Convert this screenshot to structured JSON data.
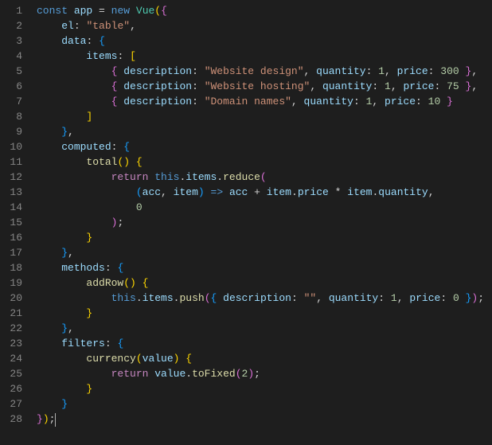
{
  "editor": {
    "line_count": 28,
    "cursor_line": 28,
    "language": "javascript"
  },
  "tokens": {
    "l1": [
      [
        "kw",
        "const"
      ],
      [
        "pun",
        " "
      ],
      [
        "var",
        "app"
      ],
      [
        "pun",
        " "
      ],
      [
        "pun",
        "="
      ],
      [
        "pun",
        " "
      ],
      [
        "kw",
        "new"
      ],
      [
        "pun",
        " "
      ],
      [
        "cls",
        "Vue"
      ],
      [
        "brk1",
        "("
      ],
      [
        "brk2",
        "{"
      ]
    ],
    "l2": [
      [
        "pun",
        "    "
      ],
      [
        "var",
        "el"
      ],
      [
        "pun",
        ":"
      ],
      [
        "pun",
        " "
      ],
      [
        "str",
        "\"table\""
      ],
      [
        "pun",
        ","
      ]
    ],
    "l3": [
      [
        "pun",
        "    "
      ],
      [
        "var",
        "data"
      ],
      [
        "pun",
        ":"
      ],
      [
        "pun",
        " "
      ],
      [
        "brk3",
        "{"
      ]
    ],
    "l4": [
      [
        "pun",
        "        "
      ],
      [
        "var",
        "items"
      ],
      [
        "pun",
        ":"
      ],
      [
        "pun",
        " "
      ],
      [
        "brk1",
        "["
      ]
    ],
    "l5": [
      [
        "pun",
        "            "
      ],
      [
        "brk2",
        "{"
      ],
      [
        "pun",
        " "
      ],
      [
        "var",
        "description"
      ],
      [
        "pun",
        ":"
      ],
      [
        "pun",
        " "
      ],
      [
        "str",
        "\"Website design\""
      ],
      [
        "pun",
        ","
      ],
      [
        "pun",
        " "
      ],
      [
        "var",
        "quantity"
      ],
      [
        "pun",
        ":"
      ],
      [
        "pun",
        " "
      ],
      [
        "num",
        "1"
      ],
      [
        "pun",
        ","
      ],
      [
        "pun",
        " "
      ],
      [
        "var",
        "price"
      ],
      [
        "pun",
        ":"
      ],
      [
        "pun",
        " "
      ],
      [
        "num",
        "300"
      ],
      [
        "pun",
        " "
      ],
      [
        "brk2",
        "}"
      ],
      [
        "pun",
        ","
      ]
    ],
    "l6": [
      [
        "pun",
        "            "
      ],
      [
        "brk2",
        "{"
      ],
      [
        "pun",
        " "
      ],
      [
        "var",
        "description"
      ],
      [
        "pun",
        ":"
      ],
      [
        "pun",
        " "
      ],
      [
        "str",
        "\"Website hosting\""
      ],
      [
        "pun",
        ","
      ],
      [
        "pun",
        " "
      ],
      [
        "var",
        "quantity"
      ],
      [
        "pun",
        ":"
      ],
      [
        "pun",
        " "
      ],
      [
        "num",
        "1"
      ],
      [
        "pun",
        ","
      ],
      [
        "pun",
        " "
      ],
      [
        "var",
        "price"
      ],
      [
        "pun",
        ":"
      ],
      [
        "pun",
        " "
      ],
      [
        "num",
        "75"
      ],
      [
        "pun",
        " "
      ],
      [
        "brk2",
        "}"
      ],
      [
        "pun",
        ","
      ]
    ],
    "l7": [
      [
        "pun",
        "            "
      ],
      [
        "brk2",
        "{"
      ],
      [
        "pun",
        " "
      ],
      [
        "var",
        "description"
      ],
      [
        "pun",
        ":"
      ],
      [
        "pun",
        " "
      ],
      [
        "str",
        "\"Domain names\""
      ],
      [
        "pun",
        ","
      ],
      [
        "pun",
        " "
      ],
      [
        "var",
        "quantity"
      ],
      [
        "pun",
        ":"
      ],
      [
        "pun",
        " "
      ],
      [
        "num",
        "1"
      ],
      [
        "pun",
        ","
      ],
      [
        "pun",
        " "
      ],
      [
        "var",
        "price"
      ],
      [
        "pun",
        ":"
      ],
      [
        "pun",
        " "
      ],
      [
        "num",
        "10"
      ],
      [
        "pun",
        " "
      ],
      [
        "brk2",
        "}"
      ]
    ],
    "l8": [
      [
        "pun",
        "        "
      ],
      [
        "brk1",
        "]"
      ]
    ],
    "l9": [
      [
        "pun",
        "    "
      ],
      [
        "brk3",
        "}"
      ],
      [
        "pun",
        ","
      ]
    ],
    "l10": [
      [
        "pun",
        "    "
      ],
      [
        "var",
        "computed"
      ],
      [
        "pun",
        ":"
      ],
      [
        "pun",
        " "
      ],
      [
        "brk3",
        "{"
      ]
    ],
    "l11": [
      [
        "pun",
        "        "
      ],
      [
        "fn",
        "total"
      ],
      [
        "brk1",
        "("
      ],
      [
        "brk1",
        ")"
      ],
      [
        "pun",
        " "
      ],
      [
        "brk1",
        "{"
      ]
    ],
    "l12": [
      [
        "pun",
        "            "
      ],
      [
        "kw2",
        "return"
      ],
      [
        "pun",
        " "
      ],
      [
        "kw",
        "this"
      ],
      [
        "pun",
        "."
      ],
      [
        "var",
        "items"
      ],
      [
        "pun",
        "."
      ],
      [
        "fn",
        "reduce"
      ],
      [
        "brk2",
        "("
      ]
    ],
    "l13": [
      [
        "pun",
        "                "
      ],
      [
        "brk3",
        "("
      ],
      [
        "var",
        "acc"
      ],
      [
        "pun",
        ","
      ],
      [
        "pun",
        " "
      ],
      [
        "var",
        "item"
      ],
      [
        "brk3",
        ")"
      ],
      [
        "pun",
        " "
      ],
      [
        "kw",
        "=>"
      ],
      [
        "pun",
        " "
      ],
      [
        "var",
        "acc"
      ],
      [
        "pun",
        " "
      ],
      [
        "pun",
        "+"
      ],
      [
        "pun",
        " "
      ],
      [
        "var",
        "item"
      ],
      [
        "pun",
        "."
      ],
      [
        "var",
        "price"
      ],
      [
        "pun",
        " "
      ],
      [
        "pun",
        "*"
      ],
      [
        "pun",
        " "
      ],
      [
        "var",
        "item"
      ],
      [
        "pun",
        "."
      ],
      [
        "var",
        "quantity"
      ],
      [
        "pun",
        ","
      ]
    ],
    "l14": [
      [
        "pun",
        "                "
      ],
      [
        "num",
        "0"
      ]
    ],
    "l15": [
      [
        "pun",
        "            "
      ],
      [
        "brk2",
        ")"
      ],
      [
        "pun",
        ";"
      ]
    ],
    "l16": [
      [
        "pun",
        "        "
      ],
      [
        "brk1",
        "}"
      ]
    ],
    "l17": [
      [
        "pun",
        "    "
      ],
      [
        "brk3",
        "}"
      ],
      [
        "pun",
        ","
      ]
    ],
    "l18": [
      [
        "pun",
        "    "
      ],
      [
        "var",
        "methods"
      ],
      [
        "pun",
        ":"
      ],
      [
        "pun",
        " "
      ],
      [
        "brk3",
        "{"
      ]
    ],
    "l19": [
      [
        "pun",
        "        "
      ],
      [
        "fn",
        "addRow"
      ],
      [
        "brk1",
        "("
      ],
      [
        "brk1",
        ")"
      ],
      [
        "pun",
        " "
      ],
      [
        "brk1",
        "{"
      ]
    ],
    "l20": [
      [
        "pun",
        "            "
      ],
      [
        "kw",
        "this"
      ],
      [
        "pun",
        "."
      ],
      [
        "var",
        "items"
      ],
      [
        "pun",
        "."
      ],
      [
        "fn",
        "push"
      ],
      [
        "brk2",
        "("
      ],
      [
        "brk3",
        "{"
      ],
      [
        "pun",
        " "
      ],
      [
        "var",
        "description"
      ],
      [
        "pun",
        ":"
      ],
      [
        "pun",
        " "
      ],
      [
        "str",
        "\"\""
      ],
      [
        "pun",
        ","
      ],
      [
        "pun",
        " "
      ],
      [
        "var",
        "quantity"
      ],
      [
        "pun",
        ":"
      ],
      [
        "pun",
        " "
      ],
      [
        "num",
        "1"
      ],
      [
        "pun",
        ","
      ],
      [
        "pun",
        " "
      ],
      [
        "var",
        "price"
      ],
      [
        "pun",
        ":"
      ],
      [
        "pun",
        " "
      ],
      [
        "num",
        "0"
      ],
      [
        "pun",
        " "
      ],
      [
        "brk3",
        "}"
      ],
      [
        "brk2",
        ")"
      ],
      [
        "pun",
        ";"
      ]
    ],
    "l21": [
      [
        "pun",
        "        "
      ],
      [
        "brk1",
        "}"
      ]
    ],
    "l22": [
      [
        "pun",
        "    "
      ],
      [
        "brk3",
        "}"
      ],
      [
        "pun",
        ","
      ]
    ],
    "l23": [
      [
        "pun",
        "    "
      ],
      [
        "var",
        "filters"
      ],
      [
        "pun",
        ":"
      ],
      [
        "pun",
        " "
      ],
      [
        "brk3",
        "{"
      ]
    ],
    "l24": [
      [
        "pun",
        "        "
      ],
      [
        "fn",
        "currency"
      ],
      [
        "brk1",
        "("
      ],
      [
        "var",
        "value"
      ],
      [
        "brk1",
        ")"
      ],
      [
        "pun",
        " "
      ],
      [
        "brk1",
        "{"
      ]
    ],
    "l25": [
      [
        "pun",
        "            "
      ],
      [
        "kw2",
        "return"
      ],
      [
        "pun",
        " "
      ],
      [
        "var",
        "value"
      ],
      [
        "pun",
        "."
      ],
      [
        "fn",
        "toFixed"
      ],
      [
        "brk2",
        "("
      ],
      [
        "num",
        "2"
      ],
      [
        "brk2",
        ")"
      ],
      [
        "pun",
        ";"
      ]
    ],
    "l26": [
      [
        "pun",
        "        "
      ],
      [
        "brk1",
        "}"
      ]
    ],
    "l27": [
      [
        "pun",
        "    "
      ],
      [
        "brk3",
        "}"
      ]
    ],
    "l28": [
      [
        "brk2",
        "}"
      ],
      [
        "brk1",
        ")"
      ],
      [
        "pun",
        ";"
      ]
    ]
  }
}
